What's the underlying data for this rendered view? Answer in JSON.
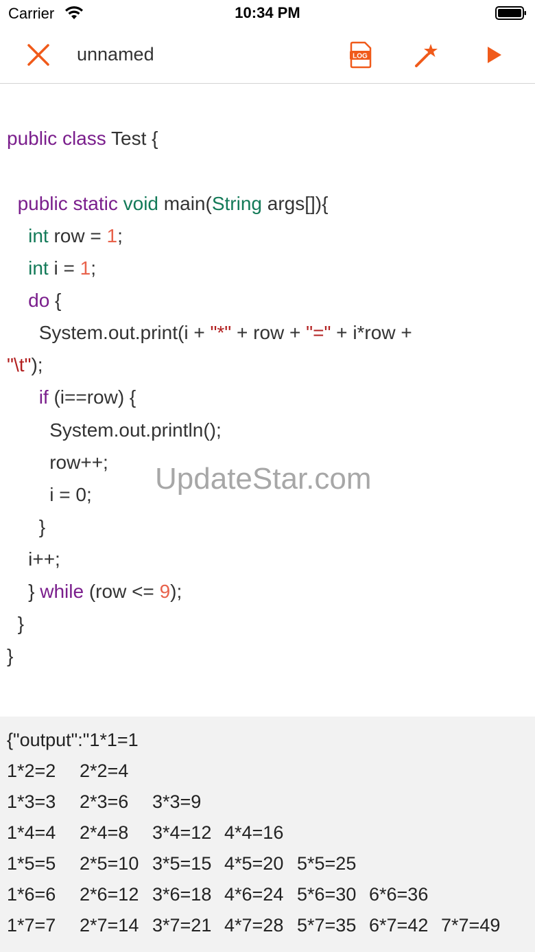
{
  "status_bar": {
    "carrier": "Carrier",
    "time": "10:34 PM"
  },
  "toolbar": {
    "title": "unnamed",
    "log_label": "LOG",
    "accent": "#f05a1a"
  },
  "code": {
    "l1": {
      "a": "public class",
      "b": " Test {"
    },
    "l2": {
      "a": "public static",
      "b": "void",
      "c": " main(",
      "d": "String",
      "e": " args[]){"
    },
    "l3": {
      "a": "int",
      "b": " row = ",
      "c": "1",
      "d": ";"
    },
    "l4": {
      "a": "int",
      "b": " i = ",
      "c": "1",
      "d": ";"
    },
    "l5": {
      "a": "do",
      "b": " {"
    },
    "l6": {
      "a": "System.out.print(i + ",
      "b": "\"*\"",
      "c": " + row + ",
      "d": "\"=\"",
      "e": " + i*row +"
    },
    "l7": {
      "a": "\"\\t\"",
      "b": ");"
    },
    "l8": {
      "a": "if",
      "b": " (i==row) {"
    },
    "l9": "System.out.println();",
    "l10": "row++;",
    "l11": "i = 0;",
    "l12": "}",
    "l13": "i++;",
    "l14": {
      "a": "} ",
      "b": "while",
      "c": " (row <= ",
      "d": "9",
      "e": ");"
    },
    "l15": "}",
    "l16": "}"
  },
  "watermark": "UpdateStar.com",
  "output": {
    "header": "{\"output\":\"1*1=1",
    "rows": [
      [
        "1*2=2",
        "2*2=4"
      ],
      [
        "1*3=3",
        "2*3=6",
        "3*3=9"
      ],
      [
        "1*4=4",
        "2*4=8",
        "3*4=12",
        "4*4=16"
      ],
      [
        "1*5=5",
        "2*5=10",
        "3*5=15",
        "4*5=20",
        "5*5=25"
      ],
      [
        "1*6=6",
        "2*6=12",
        "3*6=18",
        "4*6=24",
        "5*6=30",
        "6*6=36"
      ],
      [
        "1*7=7",
        "2*7=14",
        "3*7=21",
        "4*7=28",
        "5*7=35",
        "6*7=42",
        "7*7=49"
      ]
    ]
  }
}
